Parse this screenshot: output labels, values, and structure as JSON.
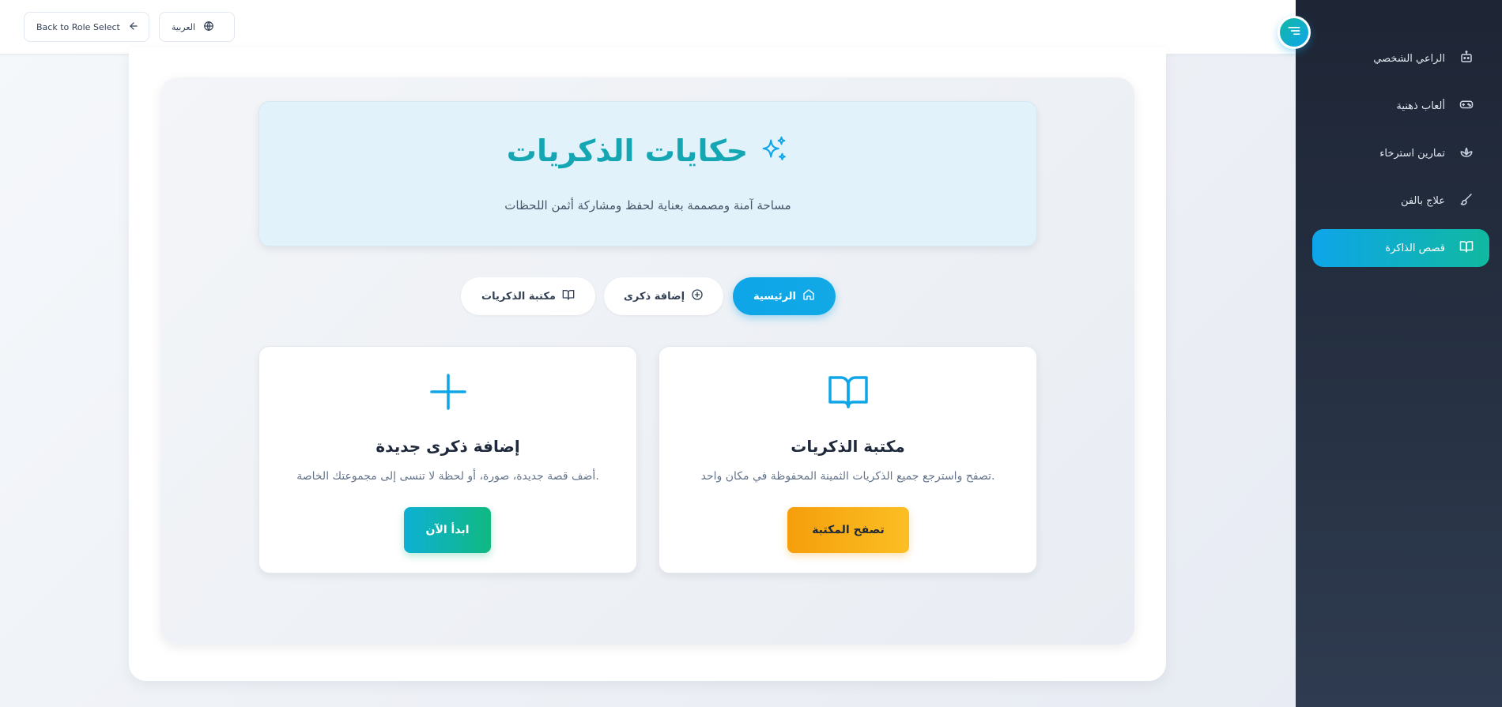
{
  "topbar": {
    "back_label": "Back to Role Select",
    "language_label": "العربية"
  },
  "sidebar": {
    "items": [
      {
        "label": "الراعي الشخصي",
        "icon": "robot-icon"
      },
      {
        "label": "ألعاب ذهنية",
        "icon": "gamepad-icon"
      },
      {
        "label": "تمارين استرخاء",
        "icon": "lotus-icon"
      },
      {
        "label": "علاج بالفن",
        "icon": "brush-icon"
      },
      {
        "label": "قصص الذاكرة",
        "icon": "book-open-icon",
        "active": true
      }
    ]
  },
  "hero": {
    "title": "حكايات الذكريات",
    "subtitle": "مساحة آمنة ومصممة بعناية لحفظ ومشاركة أثمن اللحظات"
  },
  "tabs": {
    "home": "الرئيسية",
    "add": "إضافة ذكرى",
    "library": "مكتبة الذكريات"
  },
  "cards": {
    "add": {
      "title": "إضافة ذكرى جديدة",
      "description": "أضف قصة جديدة، صورة، أو لحظة لا تنسى إلى مجموعتك الخاصة.",
      "button": "ابدأ الآن"
    },
    "library": {
      "title": "مكتبة الذكريات",
      "description": "تصفح واسترجع جميع الذكريات الثمينة المحفوظة في مكان واحد.",
      "button": "تصفح المكتبة"
    }
  },
  "colors": {
    "primary": "#0ea5e9",
    "teal": "#14a7b3",
    "amber": "#f59e0b",
    "sidebar": "#1e2535"
  }
}
